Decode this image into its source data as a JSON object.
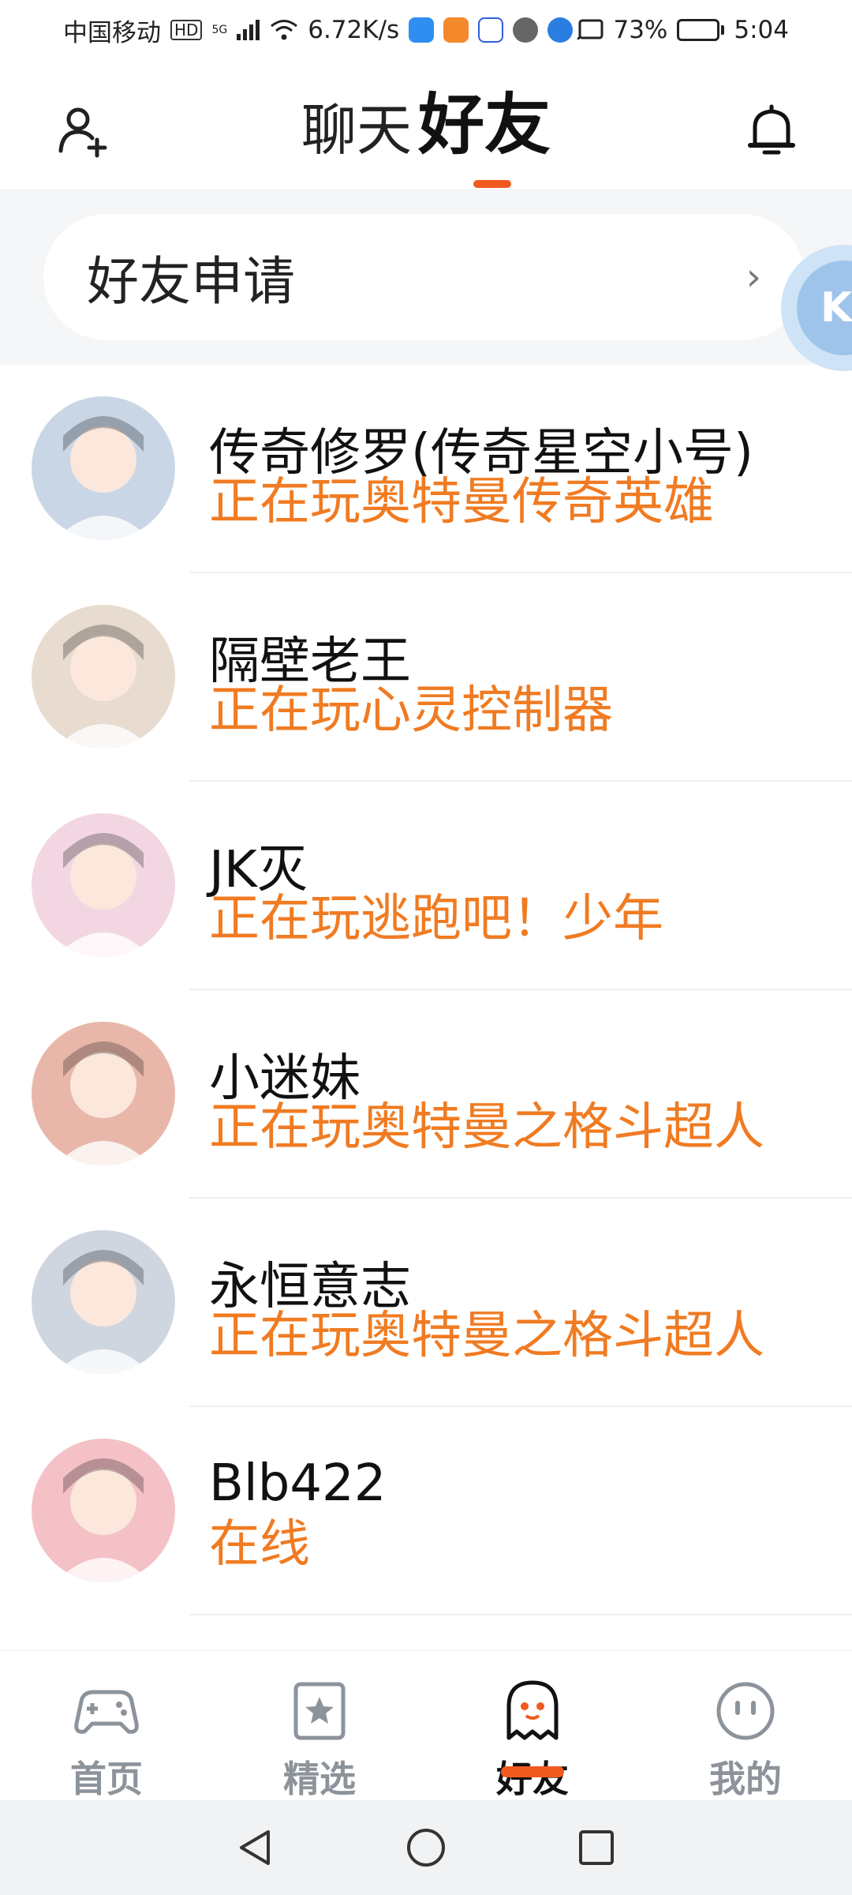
{
  "status_bar": {
    "carrier": "中国移动",
    "hd_badge": "HD",
    "network": "5G",
    "speed": "6.72K/s",
    "battery_percent": "73%",
    "battery_level": 0.73,
    "time": "5:04"
  },
  "header": {
    "tabs": [
      {
        "label": "聊天",
        "active": false
      },
      {
        "label": "好友",
        "active": true
      }
    ],
    "left_icon": "add-friend-icon",
    "right_icon": "bell-icon"
  },
  "friend_request": {
    "label": "好友申请",
    "chevron": "›"
  },
  "floating_ball": {
    "letter": "K"
  },
  "friends": [
    {
      "name": "传奇修罗(传奇星空小号)",
      "status": "正在玩奥特曼传奇英雄",
      "avatar_color": "#c9d6e6"
    },
    {
      "name": "隔壁老王",
      "status": "正在玩心灵控制器",
      "avatar_color": "#e7dccf"
    },
    {
      "name": "JK灭",
      "status": "正在玩逃跑吧！少年",
      "avatar_color": "#f2d7e3"
    },
    {
      "name": "小迷妹",
      "status": "正在玩奥特曼之格斗超人",
      "avatar_color": "#e8b7aa"
    },
    {
      "name": "永恒意志",
      "status": "正在玩奥特曼之格斗超人",
      "avatar_color": "#cfd6e0"
    },
    {
      "name": "Blb422",
      "status": "在线",
      "avatar_color": "#f4c1c7"
    }
  ],
  "bottom_nav": [
    {
      "label": "首页",
      "icon": "gamepad-icon",
      "active": false
    },
    {
      "label": "精选",
      "icon": "star-bookmark-icon",
      "active": false
    },
    {
      "label": "好友",
      "icon": "ghost-friend-icon",
      "active": true
    },
    {
      "label": "我的",
      "icon": "smiley-profile-icon",
      "active": false
    }
  ],
  "colors": {
    "accent": "#f15a1e",
    "status_text": "#f07b22",
    "inactive_nav": "#8d939b"
  }
}
